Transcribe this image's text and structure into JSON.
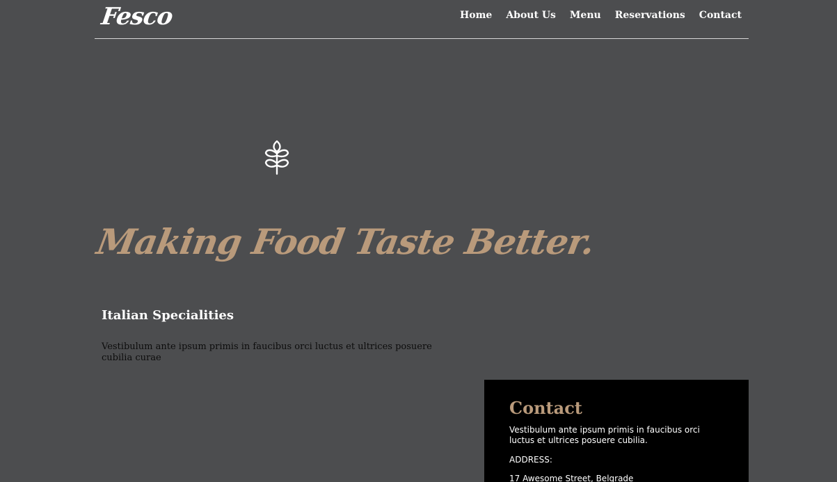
{
  "header": {
    "logo": "Fesco",
    "nav": [
      {
        "label": "Home"
      },
      {
        "label": "About Us"
      },
      {
        "label": "Menu"
      },
      {
        "label": "Reservations"
      },
      {
        "label": "Contact"
      }
    ]
  },
  "hero": {
    "icon": "wheat-icon",
    "title": "Making Food Taste Better.",
    "subheading": "Italian Specialities",
    "description": "Vestibulum ante ipsum primis in faucibus orci luctus et ultrices posuere cubilia curae"
  },
  "contact": {
    "title": "Contact",
    "text": "Vestibulum ante ipsum primis in faucibus orci luctus et ultrices posuere cubilia.",
    "address_label": "ADDRESS:",
    "address": "17 Awesome Street, Belgrade"
  },
  "colors": {
    "background": "#4c4d4f",
    "accent": "#b99a7b",
    "contact_bg": "#000000"
  }
}
